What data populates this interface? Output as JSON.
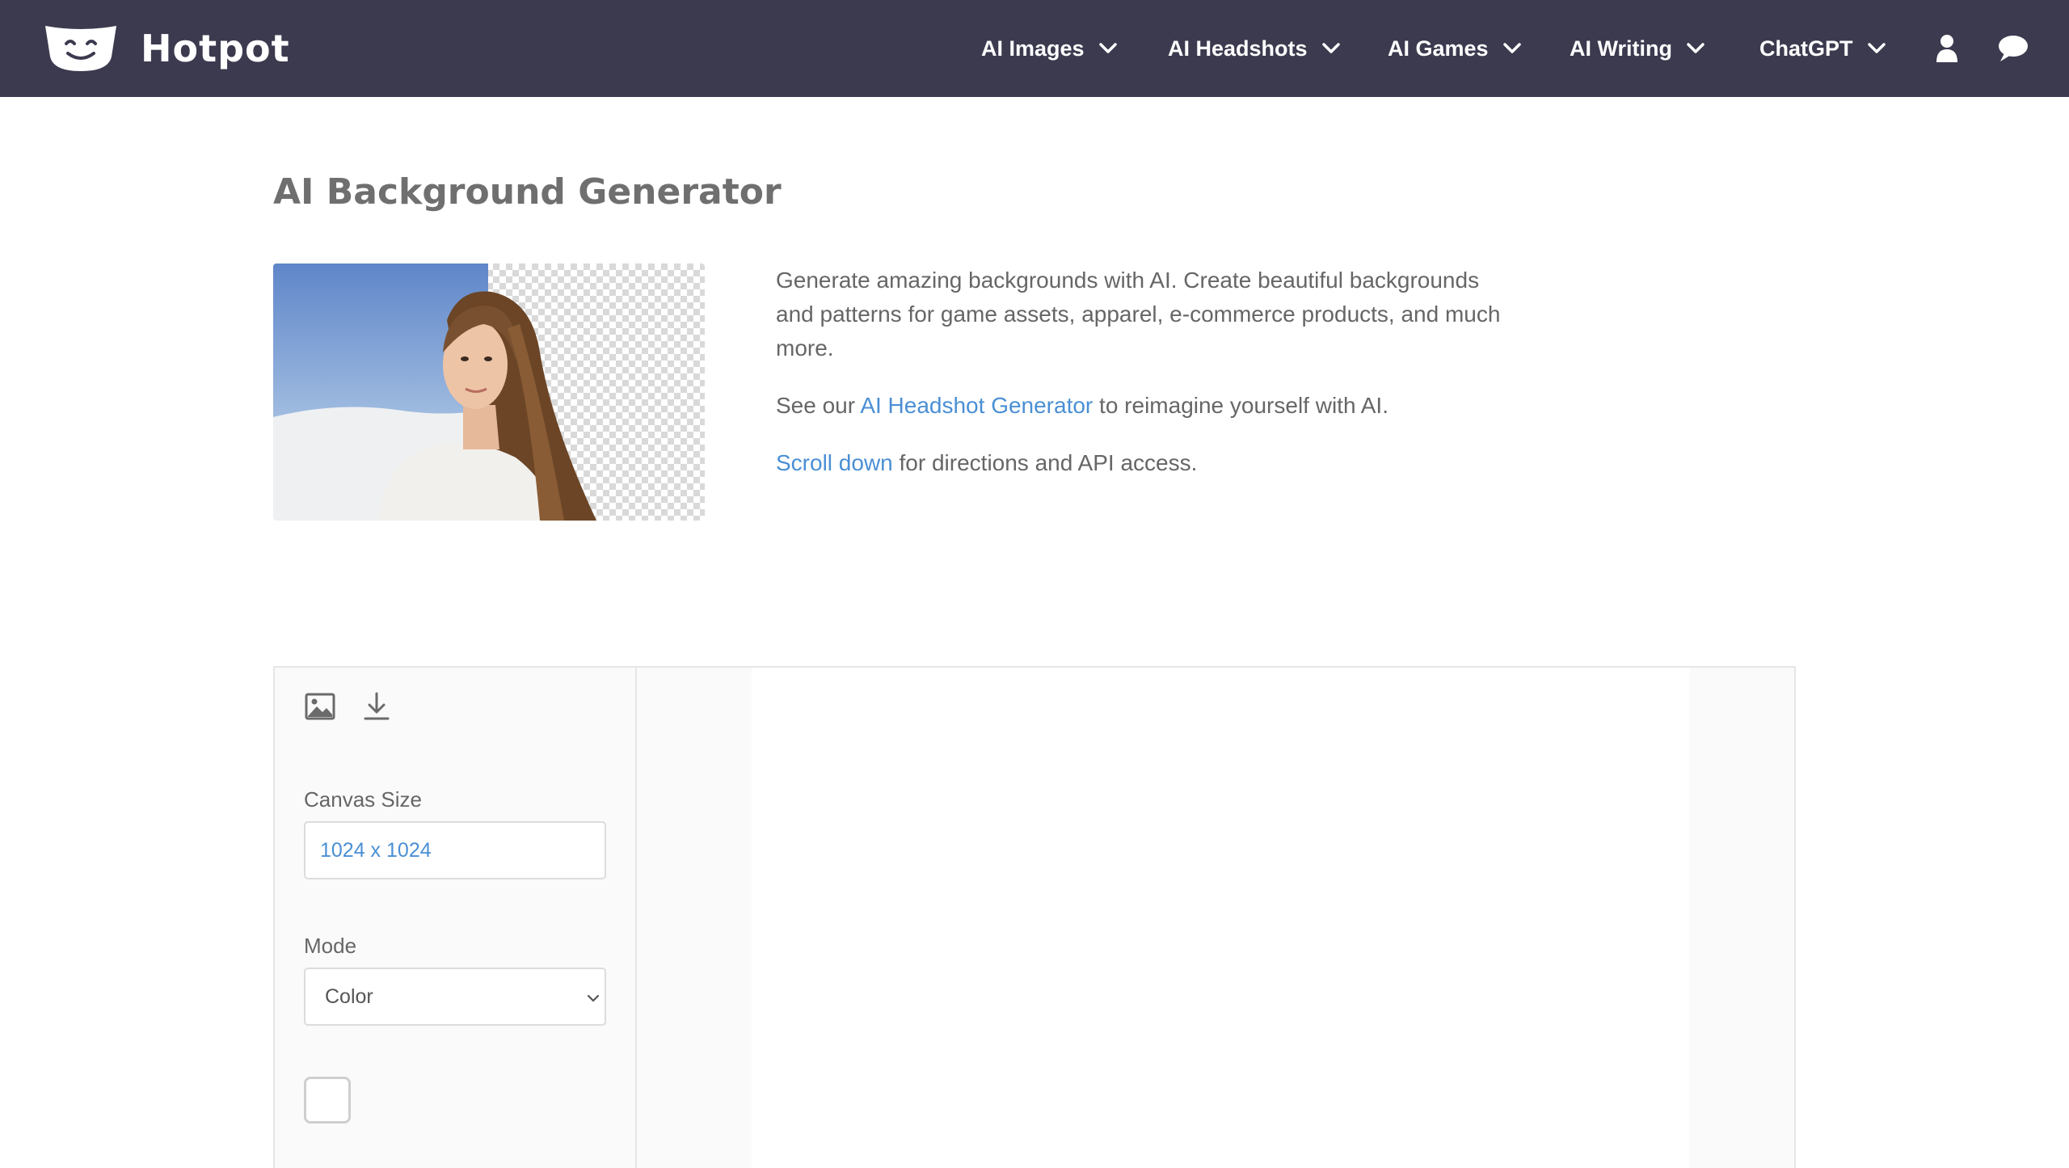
{
  "brand": {
    "name": "Hotpot"
  },
  "nav": {
    "items": [
      {
        "label": "AI Images"
      },
      {
        "label": "AI Headshots"
      },
      {
        "label": "AI Games"
      },
      {
        "label": "AI Writing"
      },
      {
        "label": "ChatGPT"
      }
    ],
    "icons": [
      "user-icon",
      "chat-icon"
    ]
  },
  "header": {
    "title": "AI Background Generator",
    "description": "Generate amazing backgrounds with AI. Create beautiful backgrounds and patterns for game assets, apparel, e-commerce products, and much more.",
    "headshot_prefix": "See our",
    "headshot_link": "AI Headshot Generator",
    "headshot_suffix": "to reimagine yourself with AI.",
    "scroll_link": "Scroll down",
    "scroll_suffix": "for directions and API access."
  },
  "tool": {
    "icons": [
      "image-icon",
      "download-icon"
    ],
    "canvas_size_label": "Canvas Size",
    "canvas_size_value": "1024 x 1024",
    "mode_label": "Mode",
    "mode_value": "Color",
    "checkbox_checked": false
  },
  "colors": {
    "navbar": "#3b3a4f",
    "link": "#4a8fd4",
    "title": "#6f6f6f"
  }
}
